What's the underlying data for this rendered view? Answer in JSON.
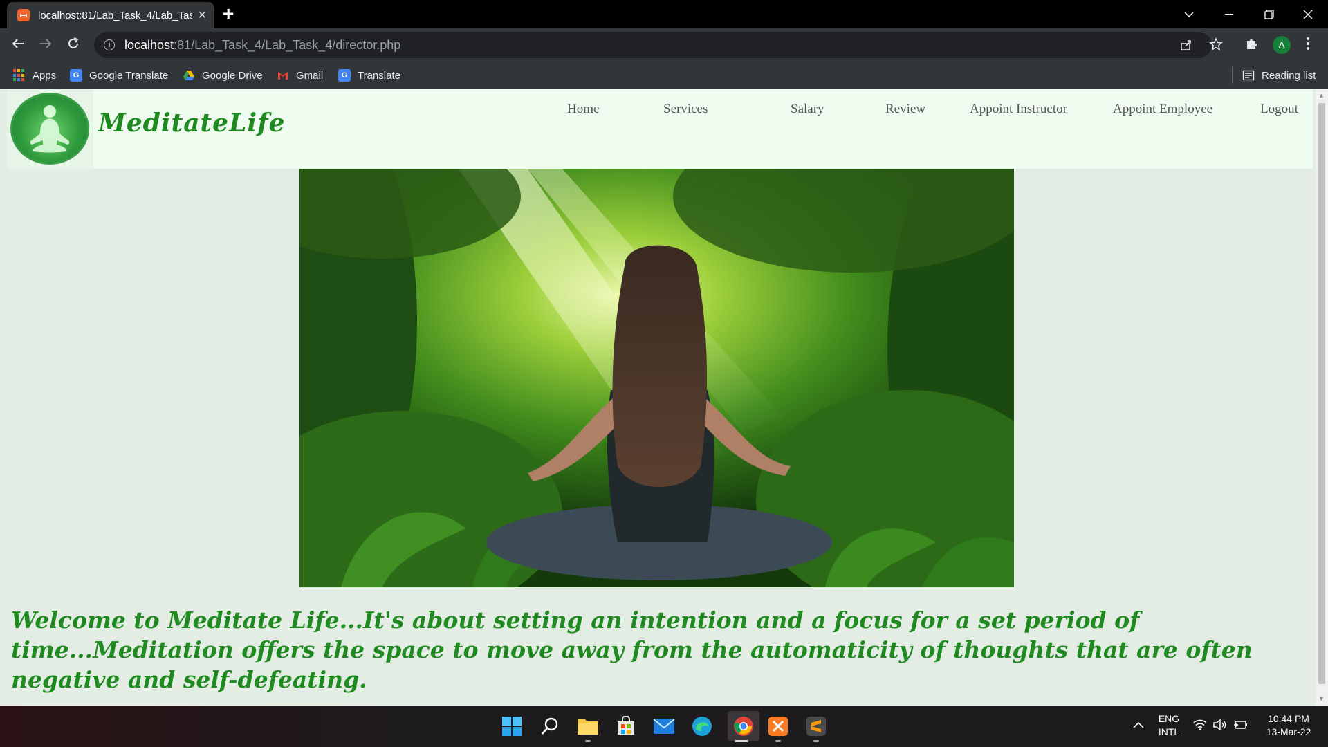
{
  "browser": {
    "tab_title": "localhost:81/Lab_Task_4/Lab_Task_4/director.php",
    "url_host": "localhost",
    "url_path": ":81/Lab_Task_4/Lab_Task_4/director.php",
    "profile_initial": "A",
    "bookmarks": [
      {
        "label": "Apps",
        "icon": "apps-grid-icon"
      },
      {
        "label": "Google Translate",
        "icon": "translate-icon"
      },
      {
        "label": "Google Drive",
        "icon": "drive-icon"
      },
      {
        "label": "Gmail",
        "icon": "gmail-icon"
      },
      {
        "label": "Translate",
        "icon": "translate-icon"
      }
    ],
    "reading_list": "Reading list"
  },
  "page": {
    "brand": "MeditateLife",
    "nav": [
      "Home",
      "Services",
      "Salary",
      "Review",
      "Appoint Instructor",
      "Appoint Employee",
      "Logout"
    ],
    "welcome_text": "Welcome to Meditate Life...It's about setting an intention and a focus for a set period of time...Meditation offers the space to move away from the automaticity of thoughts that are often negative and self-defeating."
  },
  "taskbar": {
    "language_line1": "ENG",
    "language_line2": "INTL",
    "time": "10:44 PM",
    "date": "13-Mar-22",
    "pinned_apps": [
      "start-icon",
      "search-icon",
      "file-explorer-icon",
      "store-icon",
      "mail-icon",
      "edge-icon",
      "chrome-icon",
      "xampp-icon",
      "sublime-icon"
    ]
  },
  "colors": {
    "brand_green": "#1f8a1f",
    "page_bg": "#e3ede4",
    "navbar_bg": "#effcf0"
  }
}
